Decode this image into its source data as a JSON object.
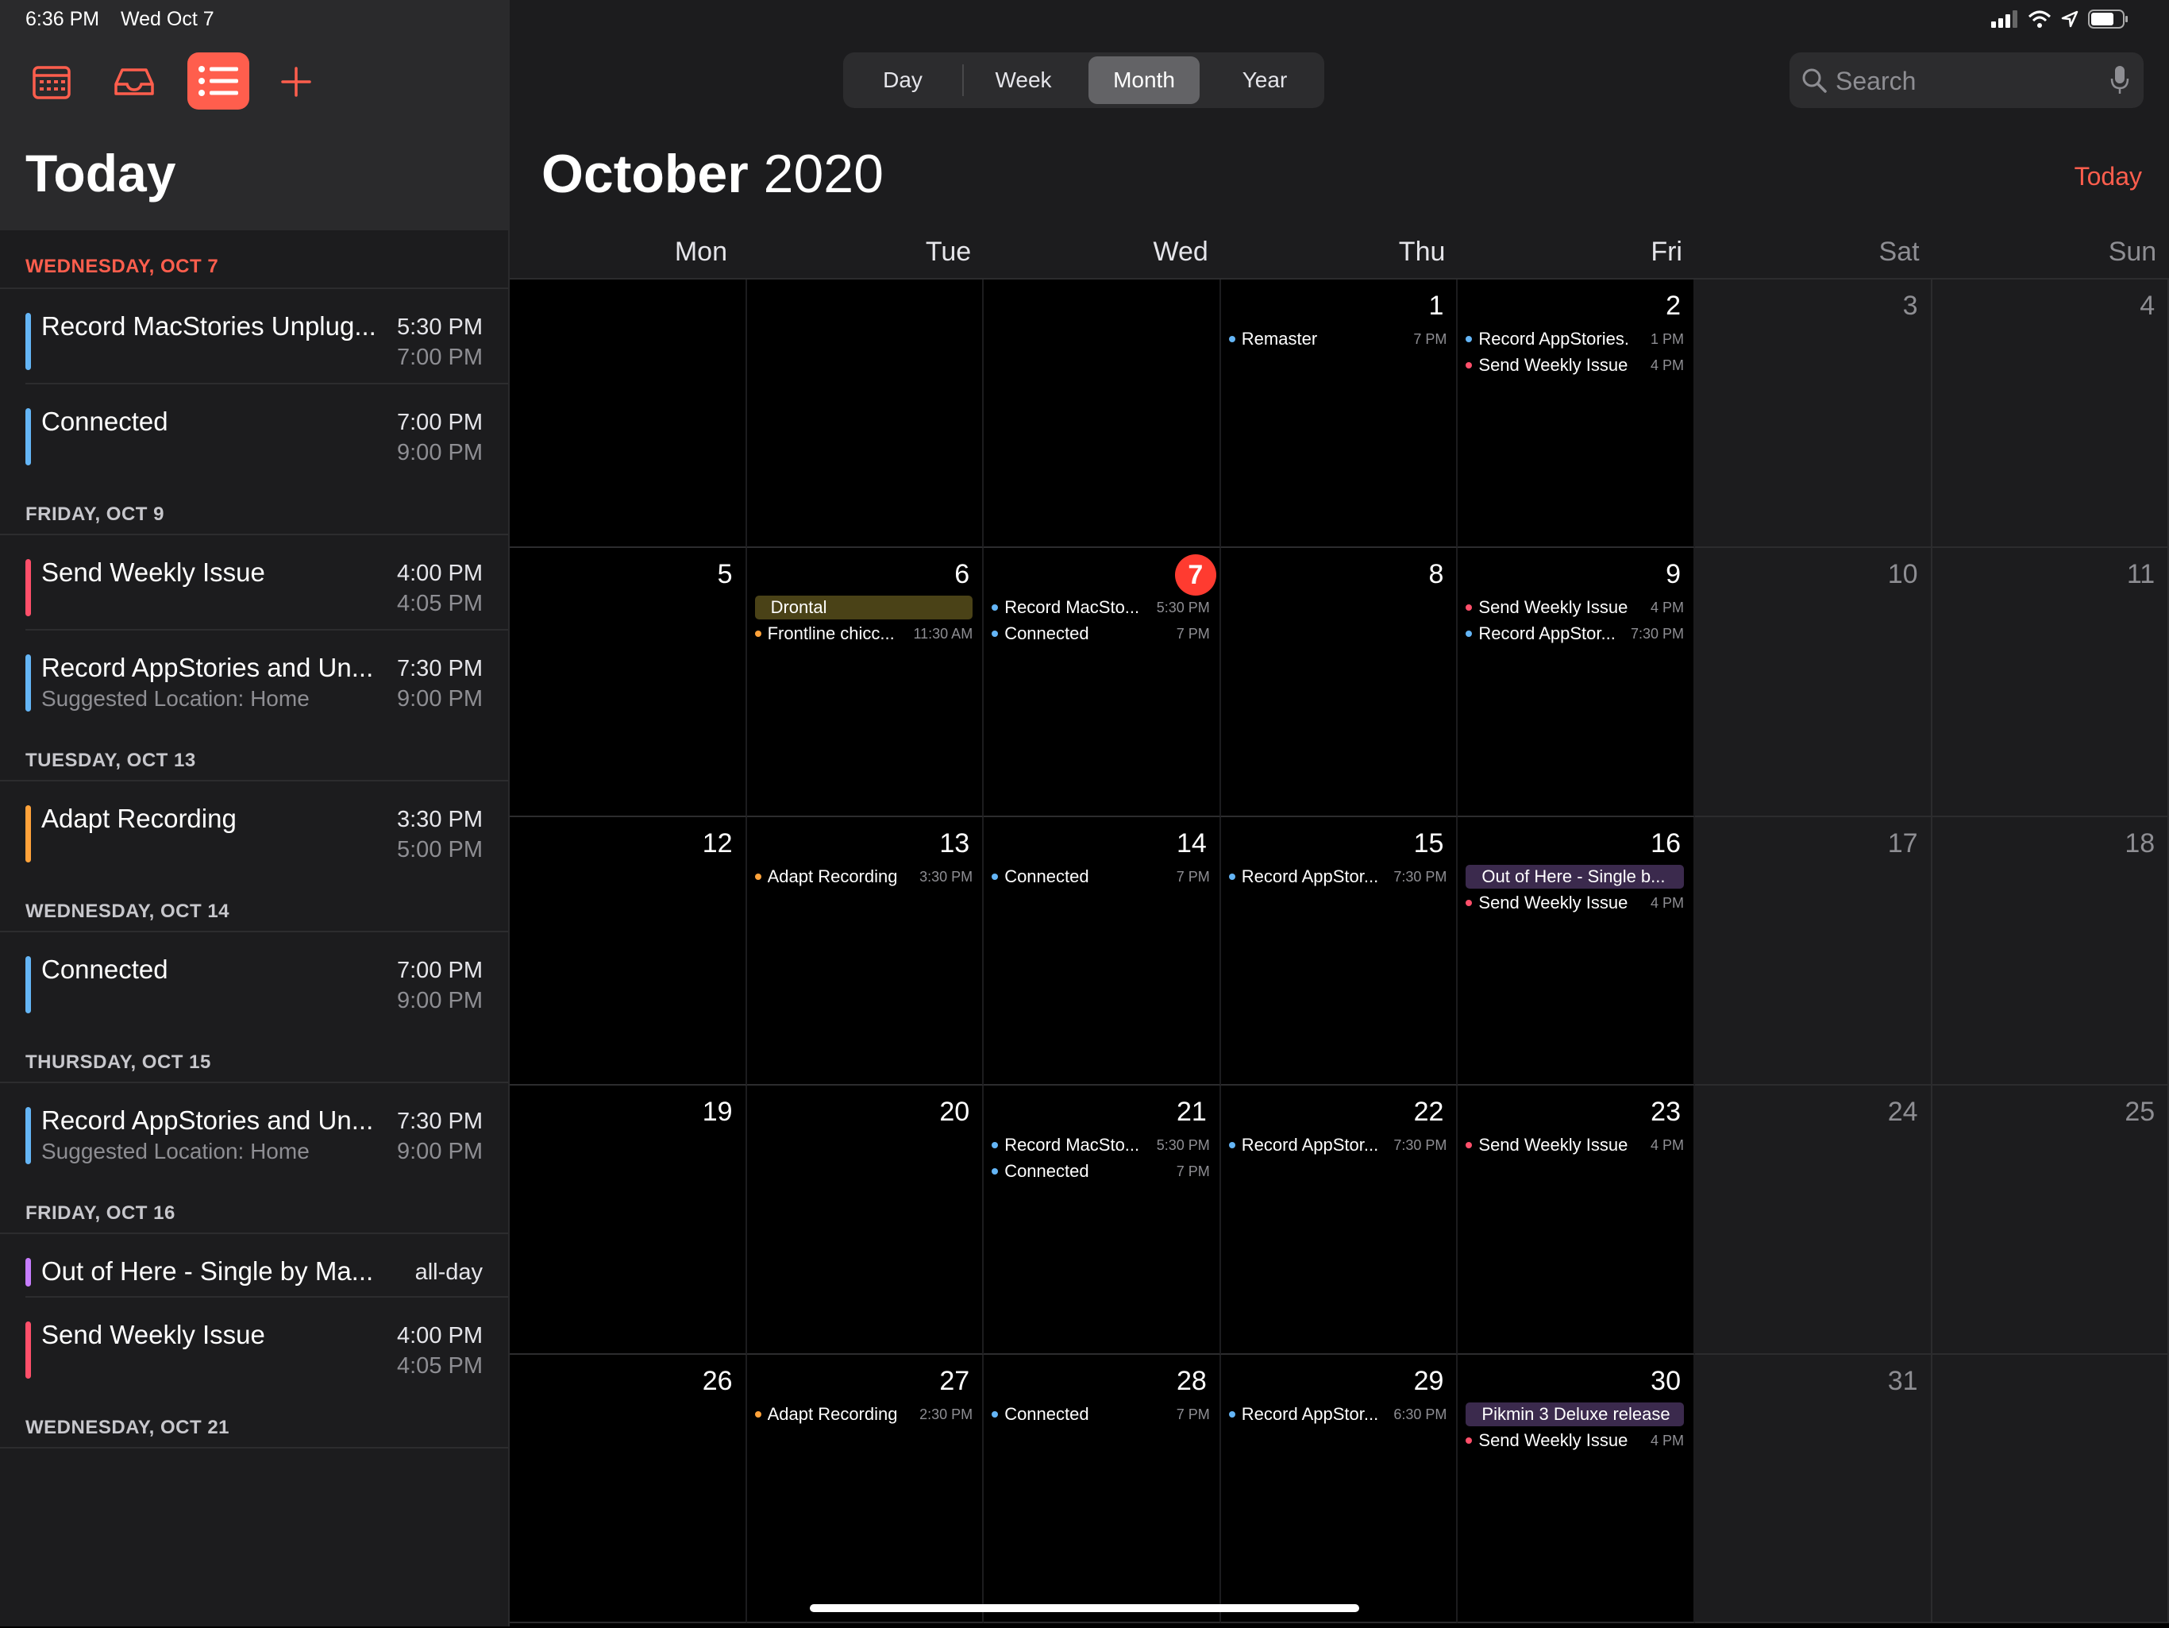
{
  "status": {
    "time": "6:36 PM",
    "date": "Wed Oct 7"
  },
  "sidebar": {
    "title": "Today",
    "days": [
      {
        "header": "WEDNESDAY, OCT 7",
        "is_today": true,
        "events": [
          {
            "title": "Record MacStories Unplug...",
            "start": "5:30 PM",
            "end": "7:00 PM",
            "color": "#64b5f6"
          },
          {
            "title": "Connected",
            "start": "7:00 PM",
            "end": "9:00 PM",
            "color": "#64b5f6"
          }
        ]
      },
      {
        "header": "FRIDAY, OCT 9",
        "events": [
          {
            "title": "Send Weekly Issue",
            "start": "4:00 PM",
            "end": "4:05 PM",
            "color": "#ff4f6a"
          },
          {
            "title": "Record AppStories and Un...",
            "subtitle": "Suggested Location: Home",
            "start": "7:30 PM",
            "end": "9:00 PM",
            "color": "#64b5f6"
          }
        ]
      },
      {
        "header": "TUESDAY, OCT 13",
        "events": [
          {
            "title": "Adapt Recording",
            "start": "3:30 PM",
            "end": "5:00 PM",
            "color": "#ffa23a"
          }
        ]
      },
      {
        "header": "WEDNESDAY, OCT 14",
        "events": [
          {
            "title": "Connected",
            "start": "7:00 PM",
            "end": "9:00 PM",
            "color": "#64b5f6"
          }
        ]
      },
      {
        "header": "THURSDAY, OCT 15",
        "events": [
          {
            "title": "Record AppStories and Un...",
            "subtitle": "Suggested Location: Home",
            "start": "7:30 PM",
            "end": "9:00 PM",
            "color": "#64b5f6"
          }
        ]
      },
      {
        "header": "FRIDAY, OCT 16",
        "events": [
          {
            "title": "Out of Here - Single by Ma...",
            "start": "all-day",
            "end": "",
            "color": "#c77dff"
          },
          {
            "title": "Send Weekly Issue",
            "start": "4:00 PM",
            "end": "4:05 PM",
            "color": "#ff4f6a"
          }
        ]
      },
      {
        "header": "WEDNESDAY, OCT 21",
        "events": []
      }
    ]
  },
  "toolbar": {
    "views": [
      "Day",
      "Week",
      "Month",
      "Year"
    ],
    "active_view": "Month",
    "search_placeholder": "Search",
    "today_label": "Today"
  },
  "calendar": {
    "month": "October",
    "year": "2020",
    "weekdays": [
      "Mon",
      "Tue",
      "Wed",
      "Thu",
      "Fri",
      "Sat",
      "Sun"
    ],
    "today": 7,
    "weeks": [
      [
        {
          "day": ""
        },
        {
          "day": ""
        },
        {
          "day": ""
        },
        {
          "day": "1",
          "events": [
            {
              "name": "Remaster",
              "time": "7 PM",
              "color": "#64b5f6"
            }
          ]
        },
        {
          "day": "2",
          "events": [
            {
              "name": "Record AppStories...",
              "time": "1 PM",
              "color": "#64b5f6"
            },
            {
              "name": "Send Weekly Issue",
              "time": "4 PM",
              "color": "#ff4f6a"
            }
          ]
        },
        {
          "day": "3"
        },
        {
          "day": "4"
        }
      ],
      [
        {
          "day": "5"
        },
        {
          "day": "6",
          "events": [
            {
              "name": "Drontal",
              "band": "#4a4217",
              "color": "#d4c24a"
            },
            {
              "name": "Frontline chicc...",
              "time": "11:30 AM",
              "color": "#ffa23a"
            }
          ]
        },
        {
          "day": "7",
          "events": [
            {
              "name": "Record MacSto...",
              "time": "5:30 PM",
              "color": "#64b5f6"
            },
            {
              "name": "Connected",
              "time": "7 PM",
              "color": "#64b5f6"
            }
          ]
        },
        {
          "day": "8"
        },
        {
          "day": "9",
          "events": [
            {
              "name": "Send Weekly Issue",
              "time": "4 PM",
              "color": "#ff4f6a"
            },
            {
              "name": "Record AppStor...",
              "time": "7:30 PM",
              "color": "#64b5f6"
            }
          ]
        },
        {
          "day": "10"
        },
        {
          "day": "11"
        }
      ],
      [
        {
          "day": "12"
        },
        {
          "day": "13",
          "events": [
            {
              "name": "Adapt Recording",
              "time": "3:30 PM",
              "color": "#ffa23a"
            }
          ]
        },
        {
          "day": "14",
          "events": [
            {
              "name": "Connected",
              "time": "7 PM",
              "color": "#64b5f6"
            }
          ]
        },
        {
          "day": "15",
          "events": [
            {
              "name": "Record AppStor...",
              "time": "7:30 PM",
              "color": "#64b5f6"
            }
          ]
        },
        {
          "day": "16",
          "events": [
            {
              "name": "Out of Here - Single b...",
              "band": "#3b2a4d",
              "color": "#c77dff"
            },
            {
              "name": "Send Weekly Issue",
              "time": "4 PM",
              "color": "#ff4f6a"
            }
          ]
        },
        {
          "day": "17"
        },
        {
          "day": "18"
        }
      ],
      [
        {
          "day": "19"
        },
        {
          "day": "20"
        },
        {
          "day": "21",
          "events": [
            {
              "name": "Record MacSto...",
              "time": "5:30 PM",
              "color": "#64b5f6"
            },
            {
              "name": "Connected",
              "time": "7 PM",
              "color": "#64b5f6"
            }
          ]
        },
        {
          "day": "22",
          "events": [
            {
              "name": "Record AppStor...",
              "time": "7:30 PM",
              "color": "#64b5f6"
            }
          ]
        },
        {
          "day": "23",
          "events": [
            {
              "name": "Send Weekly Issue",
              "time": "4 PM",
              "color": "#ff4f6a"
            }
          ]
        },
        {
          "day": "24"
        },
        {
          "day": "25"
        }
      ],
      [
        {
          "day": "26"
        },
        {
          "day": "27",
          "events": [
            {
              "name": "Adapt Recording",
              "time": "2:30 PM",
              "color": "#ffa23a"
            }
          ]
        },
        {
          "day": "28",
          "events": [
            {
              "name": "Connected",
              "time": "7 PM",
              "color": "#64b5f6"
            }
          ]
        },
        {
          "day": "29",
          "events": [
            {
              "name": "Record AppStor...",
              "time": "6:30 PM",
              "color": "#64b5f6"
            }
          ]
        },
        {
          "day": "30",
          "events": [
            {
              "name": "Pikmin 3 Deluxe release",
              "band": "#3b2a4d",
              "color": "#c77dff"
            },
            {
              "name": "Send Weekly Issue",
              "time": "4 PM",
              "color": "#ff4f6a"
            }
          ]
        },
        {
          "day": "31"
        },
        {
          "day": ""
        }
      ]
    ]
  },
  "icons": {
    "calendar": "calendar-icon",
    "inbox": "inbox-icon",
    "list": "list-icon",
    "add": "plus-icon",
    "search": "search-icon",
    "mic": "microphone-icon"
  },
  "colors": {
    "accent": "#ff5e4d",
    "today_circle": "#ff3b30"
  }
}
